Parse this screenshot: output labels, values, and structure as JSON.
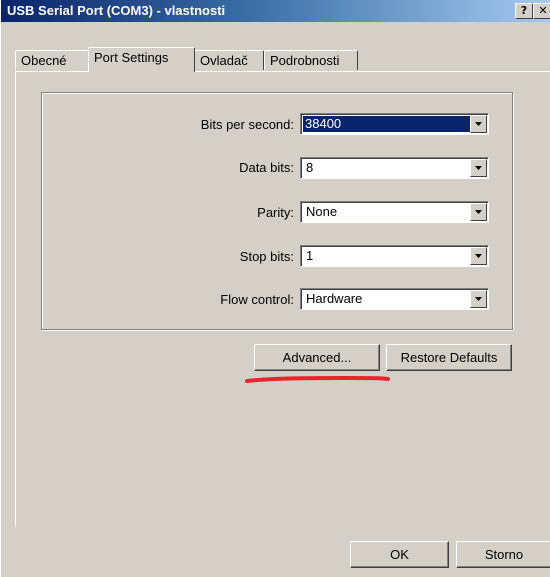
{
  "window": {
    "title": "USB Serial Port (COM3) - vlastnosti",
    "help_label": "?",
    "close_label": "✕"
  },
  "tabs": [
    {
      "label": "Obecné",
      "active": false
    },
    {
      "label": "Port Settings",
      "active": true
    },
    {
      "label": "Ovladač",
      "active": false
    },
    {
      "label": "Podrobnosti",
      "active": false
    }
  ],
  "settings": {
    "bits_per_second": {
      "label": "Bits per second:",
      "value": "38400"
    },
    "data_bits": {
      "label": "Data bits:",
      "value": "8"
    },
    "parity": {
      "label": "Parity:",
      "value": "None"
    },
    "stop_bits": {
      "label": "Stop bits:",
      "value": "1"
    },
    "flow_control": {
      "label": "Flow control:",
      "value": "Hardware"
    }
  },
  "buttons": {
    "advanced": "Advanced...",
    "restore_defaults": "Restore Defaults",
    "ok": "OK",
    "cancel": "Storno"
  },
  "colors": {
    "face": "#d4d0c8",
    "title_active": "#0a246a",
    "selection": "#0a246a",
    "annotation": "#e8252a"
  }
}
